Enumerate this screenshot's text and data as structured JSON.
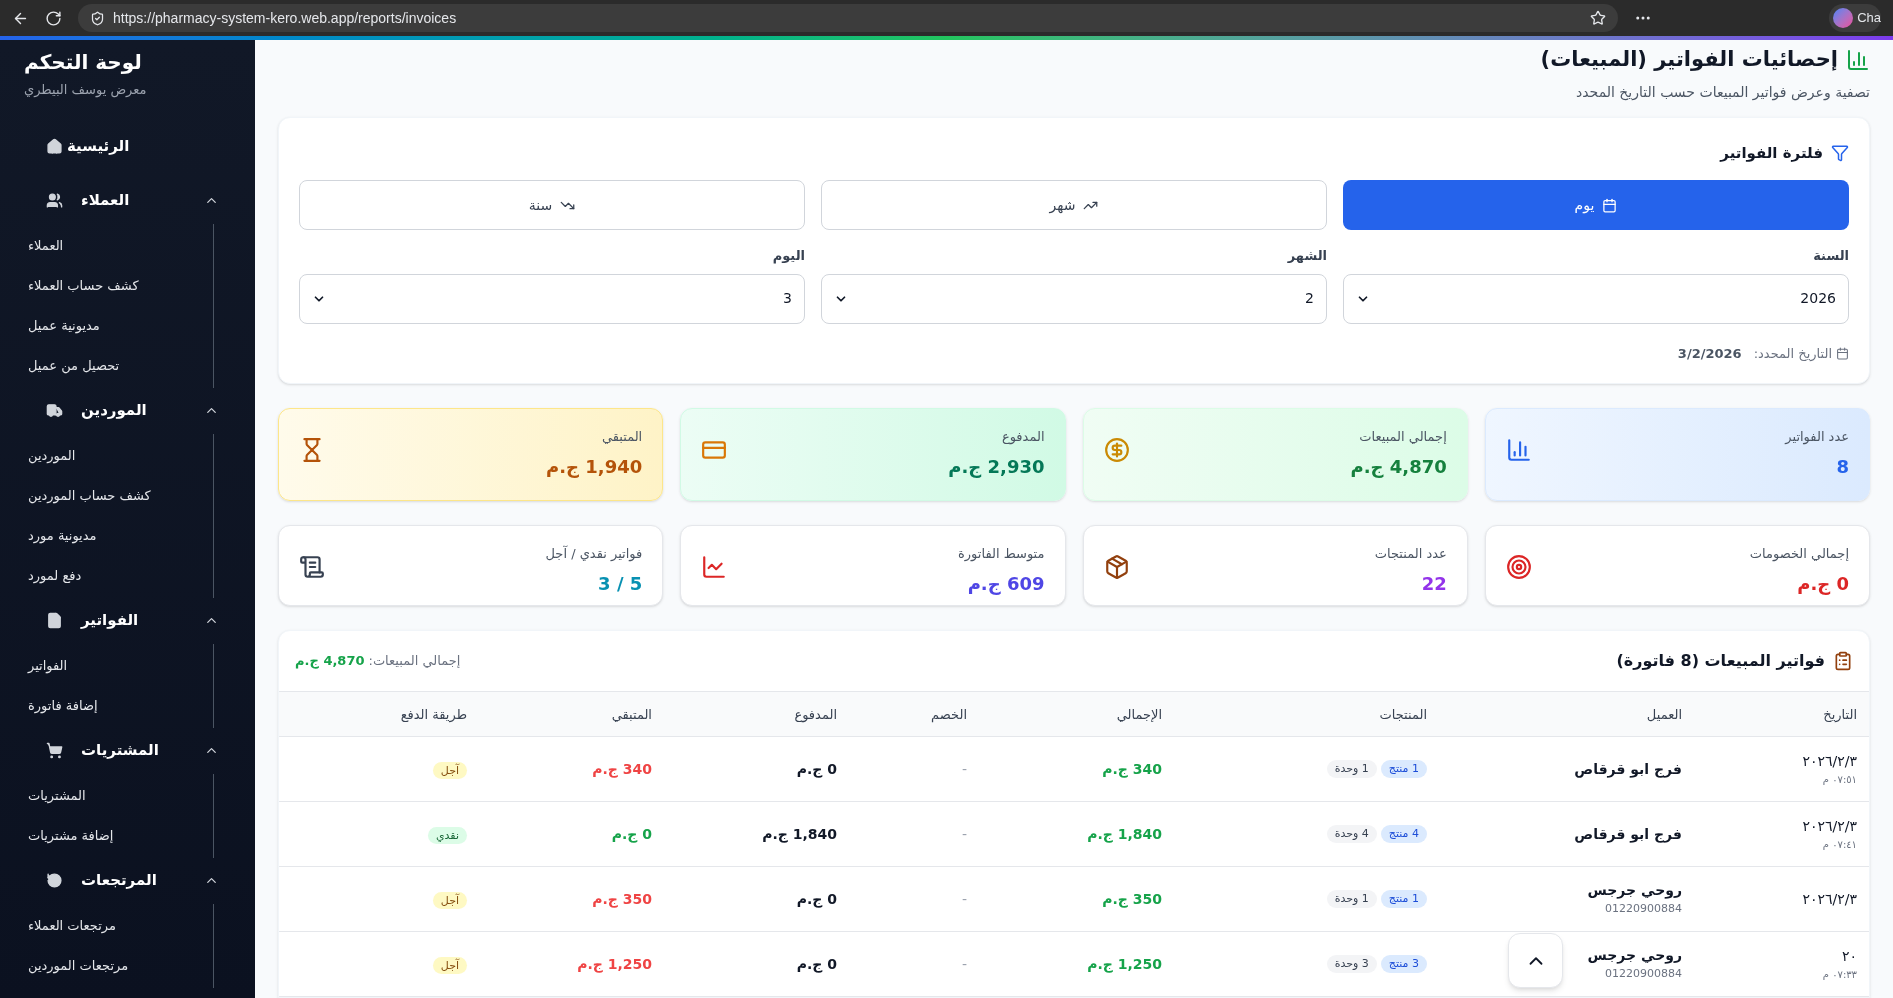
{
  "browser": {
    "url": "https://pharmacy-system-kero.web.app/reports/invoices",
    "profile_label": "Cha"
  },
  "sidebar": {
    "title": "لوحة التحكم",
    "subtitle": "معرض يوسف البيطري",
    "home": {
      "label": "الرئيسية"
    },
    "groups": [
      {
        "label": "العملاء",
        "expanded": true,
        "children": [
          {
            "label": "العملاء"
          },
          {
            "label": "كشف حساب العملاء"
          },
          {
            "label": "مديونية عميل"
          },
          {
            "label": "تحصيل من عميل"
          }
        ]
      },
      {
        "label": "الموردين",
        "expanded": true,
        "children": [
          {
            "label": "الموردين"
          },
          {
            "label": "كشف حساب الموردين"
          },
          {
            "label": "مديونية مورد"
          },
          {
            "label": "دفع لمورد"
          }
        ]
      },
      {
        "label": "الفواتير",
        "expanded": true,
        "children": [
          {
            "label": "الفواتير"
          },
          {
            "label": "إضافة فاتورة"
          }
        ]
      },
      {
        "label": "المشتريات",
        "expanded": true,
        "children": [
          {
            "label": "المشتريات"
          },
          {
            "label": "إضافة مشتريات"
          }
        ]
      },
      {
        "label": "المرتجعات",
        "expanded": true,
        "children": [
          {
            "label": "مرتجعات العملاء"
          },
          {
            "label": "مرتجعات الموردين"
          }
        ]
      }
    ]
  },
  "page": {
    "title": "إحصائيات الفواتير (المبيعات)",
    "subtitle": "تصفية وعرض فواتير المبيعات حسب التاريخ المحدد"
  },
  "filter": {
    "title": "فلترة الفواتير",
    "tabs": [
      {
        "label": "يوم",
        "selected": true
      },
      {
        "label": "شهر",
        "selected": false
      },
      {
        "label": "سنة",
        "selected": false
      }
    ],
    "selects": [
      {
        "label": "السنة",
        "value": "2026"
      },
      {
        "label": "الشهر",
        "value": "2"
      },
      {
        "label": "اليوم",
        "value": "3"
      }
    ],
    "selected_date": {
      "label": "التاريخ المحدد:",
      "value": "3/2/2026"
    }
  },
  "stats": [
    {
      "label": "عدد الفواتير",
      "value": "8",
      "color": "#2563eb",
      "tinted": true
    },
    {
      "label": "إجمالي المبيعات",
      "value": "4,870 ج.م",
      "color": "#15803d",
      "tinted": true
    },
    {
      "label": "المدفوع",
      "value": "2,930 ج.م",
      "color": "#047857",
      "tinted": true
    },
    {
      "label": "المتبقي",
      "value": "1,940 ج.م",
      "color": "#b45309",
      "tinted": true
    },
    {
      "label": "إجمالي الخصومات",
      "value": "0 ج.م",
      "color": "#dc2626",
      "tinted": false
    },
    {
      "label": "عدد المنتجات",
      "value": "22",
      "color": "#9333ea",
      "tinted": false
    },
    {
      "label": "متوسط الفاتورة",
      "value": "609 ج.م",
      "color": "#4f46e5",
      "tinted": false
    },
    {
      "label": "فواتير نقدي / آجل",
      "value": "5 / 3",
      "color": "#0891b2",
      "tinted": false
    }
  ],
  "invoices": {
    "title": "فواتير المبيعات (8 فاتورة)",
    "total_label": "إجمالي المبيعات:",
    "total_value": "4,870 ج.م",
    "columns": [
      "التاريخ",
      "العميل",
      "المنتجات",
      "الإجمالي",
      "الخصم",
      "المدفوع",
      "المتبقي",
      "طريقة الدفع"
    ],
    "rows": [
      {
        "date": "٢٠٢٦/٢/٣",
        "time": "٠٧:٥١ م",
        "customer": "فرج ابو قرقاص",
        "products": "1 منتج",
        "units": "1 وحدة",
        "total": "340 ج.م",
        "discount": "-",
        "paid": "0 ج.م",
        "remaining": "340 ج.م",
        "remaining_due": true,
        "payment": {
          "label": "آجل",
          "kind": "credit"
        }
      },
      {
        "date": "٢٠٢٦/٢/٣",
        "time": "٠٧:٤١ م",
        "customer": "فرج ابو قرقاص",
        "products": "4 منتج",
        "units": "4 وحدة",
        "total": "1,840 ج.م",
        "discount": "-",
        "paid": "1,840 ج.م",
        "remaining": "0 ج.م",
        "remaining_due": false,
        "payment": {
          "label": "نقدي",
          "kind": "cash"
        }
      },
      {
        "date": "٢٠٢٦/٢/٣",
        "customer": "روحي جرجس",
        "phone": "01220900884",
        "products": "1 منتج",
        "units": "1 وحدة",
        "total": "350 ج.م",
        "discount": "-",
        "paid": "0 ج.م",
        "remaining": "350 ج.م",
        "remaining_due": true,
        "payment": {
          "label": "آجل",
          "kind": "credit"
        }
      },
      {
        "date": "٢٠",
        "time": "٠٧:٣٣ م",
        "customer": "روحي جرجس",
        "phone": "01220900884",
        "products": "3 منتج",
        "units": "3 وحدة",
        "total": "1,250 ج.م",
        "discount": "-",
        "paid": "0 ج.م",
        "remaining": "1,250 ج.م",
        "remaining_due": true,
        "payment": {
          "label": "آجل",
          "kind": "credit"
        }
      }
    ]
  }
}
